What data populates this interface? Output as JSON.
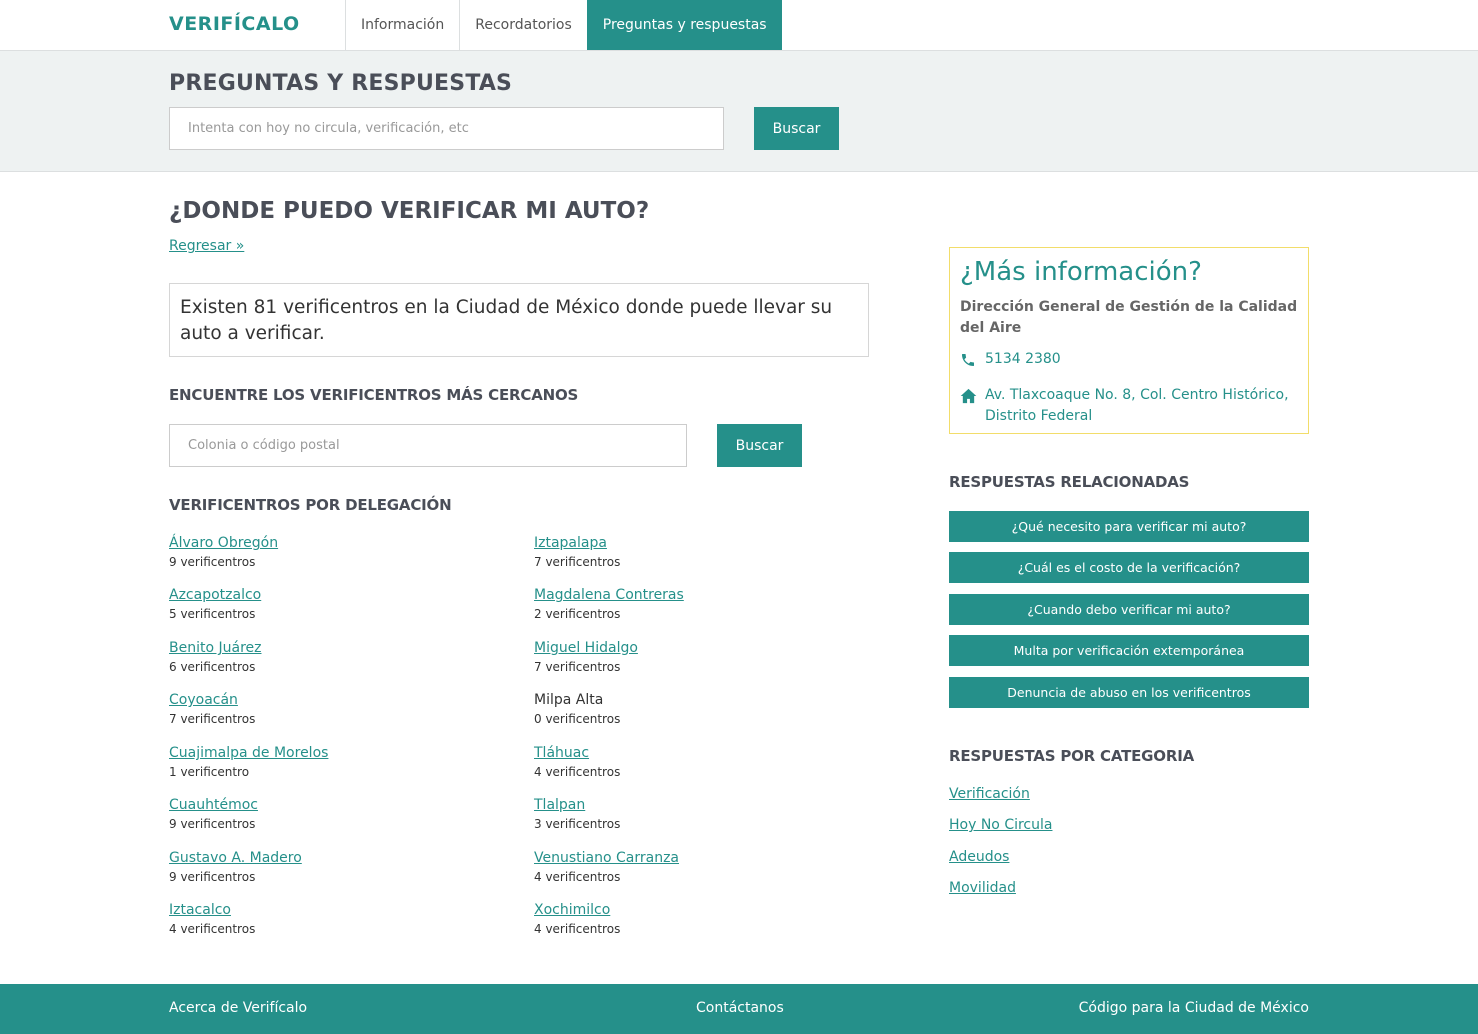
{
  "nav": {
    "brand": "VERIFÍCALO",
    "items": [
      {
        "label": "Información"
      },
      {
        "label": "Recordatorios"
      },
      {
        "label": "Preguntas y respuestas"
      }
    ]
  },
  "header": {
    "title": "PREGUNTAS Y RESPUESTAS",
    "search_placeholder": "Intenta con hoy no circula, verificación, etc",
    "search_button": "Buscar"
  },
  "question": {
    "title": "¿DONDE PUEDO VERIFICAR MI AUTO?",
    "back_link": "Regresar »",
    "answer": "Existen 81 verificentros en la Ciudad de México donde puede llevar su auto a verificar."
  },
  "nearest": {
    "heading": "ENCUENTRE LOS VERIFICENTROS MÁS CERCANOS",
    "placeholder": "Colonia o código postal",
    "button": "Buscar"
  },
  "delegations": {
    "heading": "VERIFICENTROS POR DELEGACIÓN",
    "left": [
      {
        "name": "Álvaro Obregón",
        "count": "9 verificentros"
      },
      {
        "name": "Azcapotzalco",
        "count": "5 verificentros"
      },
      {
        "name": "Benito Juárez",
        "count": "6 verificentros"
      },
      {
        "name": "Coyoacán",
        "count": "7 verificentros"
      },
      {
        "name": "Cuajimalpa de Morelos",
        "count": "1 verificentro"
      },
      {
        "name": "Cuauhtémoc",
        "count": "9 verificentros"
      },
      {
        "name": "Gustavo A. Madero",
        "count": "9 verificentros"
      },
      {
        "name": "Iztacalco",
        "count": "4 verificentros"
      }
    ],
    "right": [
      {
        "name": "Iztapalapa",
        "count": "7 verificentros"
      },
      {
        "name": "Magdalena Contreras",
        "count": "2 verificentros"
      },
      {
        "name": "Miguel Hidalgo",
        "count": "7 verificentros"
      },
      {
        "name": "Milpa Alta",
        "count": "0 verificentros"
      },
      {
        "name": "Tláhuac",
        "count": "4 verificentros"
      },
      {
        "name": "Tlalpan",
        "count": "3 verificentros"
      },
      {
        "name": "Venustiano Carranza",
        "count": "4 verificentros"
      },
      {
        "name": "Xochimilco",
        "count": "4 verificentros"
      }
    ]
  },
  "info": {
    "title": "¿Más información?",
    "org": "Dirección General de Gestión de la Calidad del Aire",
    "phone": "5134 2380",
    "address": "Av. Tlaxcoaque No. 8, Col. Centro Histórico, Distrito Federal",
    "phone_icon": "phone-icon",
    "address_icon": "home-icon"
  },
  "related": {
    "heading": "RESPUESTAS RELACIONADAS",
    "items": [
      "¿Qué necesito para verificar mi auto?",
      "¿Cuál es el costo de la verificación?",
      "¿Cuando debo verificar mi auto?",
      "Multa por verificación extemporánea",
      "Denuncia de abuso en los verificentros"
    ]
  },
  "categories": {
    "heading": "RESPUESTAS POR CATEGORIA",
    "items": [
      "Verificación",
      "Hoy No Circula",
      "Adeudos",
      "Movilidad"
    ]
  },
  "footer": {
    "about": "Acerca de Verifícalo",
    "contact": "Contáctanos",
    "code": "Código para la Ciudad de México"
  },
  "colors": {
    "accent": "#25908a",
    "band": "#eef2f2",
    "info_border": "#f2dd6a"
  }
}
